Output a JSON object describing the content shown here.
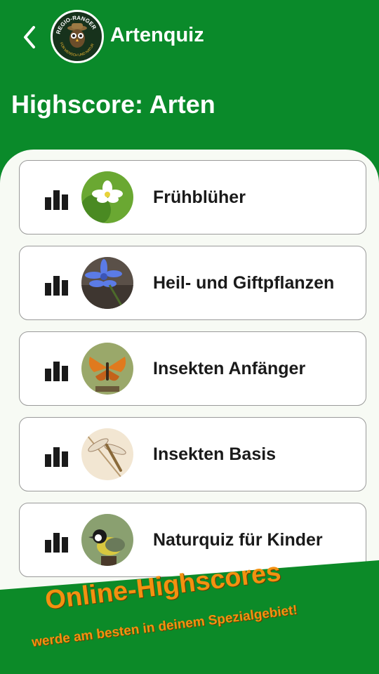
{
  "header": {
    "app_title": "Artenquiz",
    "logo_text_top": "REGIO-RANGER",
    "logo_text_bottom": "FÜR MENSCH UND NATUR",
    "page_title": "Highscore: Arten"
  },
  "categories": [
    {
      "label": "Frühblüher",
      "icon": "bar-chart-icon"
    },
    {
      "label": "Heil- und Giftpflanzen",
      "icon": "bar-chart-icon"
    },
    {
      "label": "Insekten Anfänger",
      "icon": "bar-chart-icon"
    },
    {
      "label": "Insekten Basis",
      "icon": "bar-chart-icon"
    },
    {
      "label": "Naturquiz für Kinder",
      "icon": "bar-chart-icon"
    }
  ],
  "banner": {
    "title": "Online-Highscores",
    "subtitle": "werde am besten in deinem Spezialgebiet!"
  },
  "colors": {
    "brand_green": "#0a8a2a",
    "banner_green": "#0c8a28",
    "banner_text": "#f39110",
    "panel_bg": "#f7faf4"
  }
}
